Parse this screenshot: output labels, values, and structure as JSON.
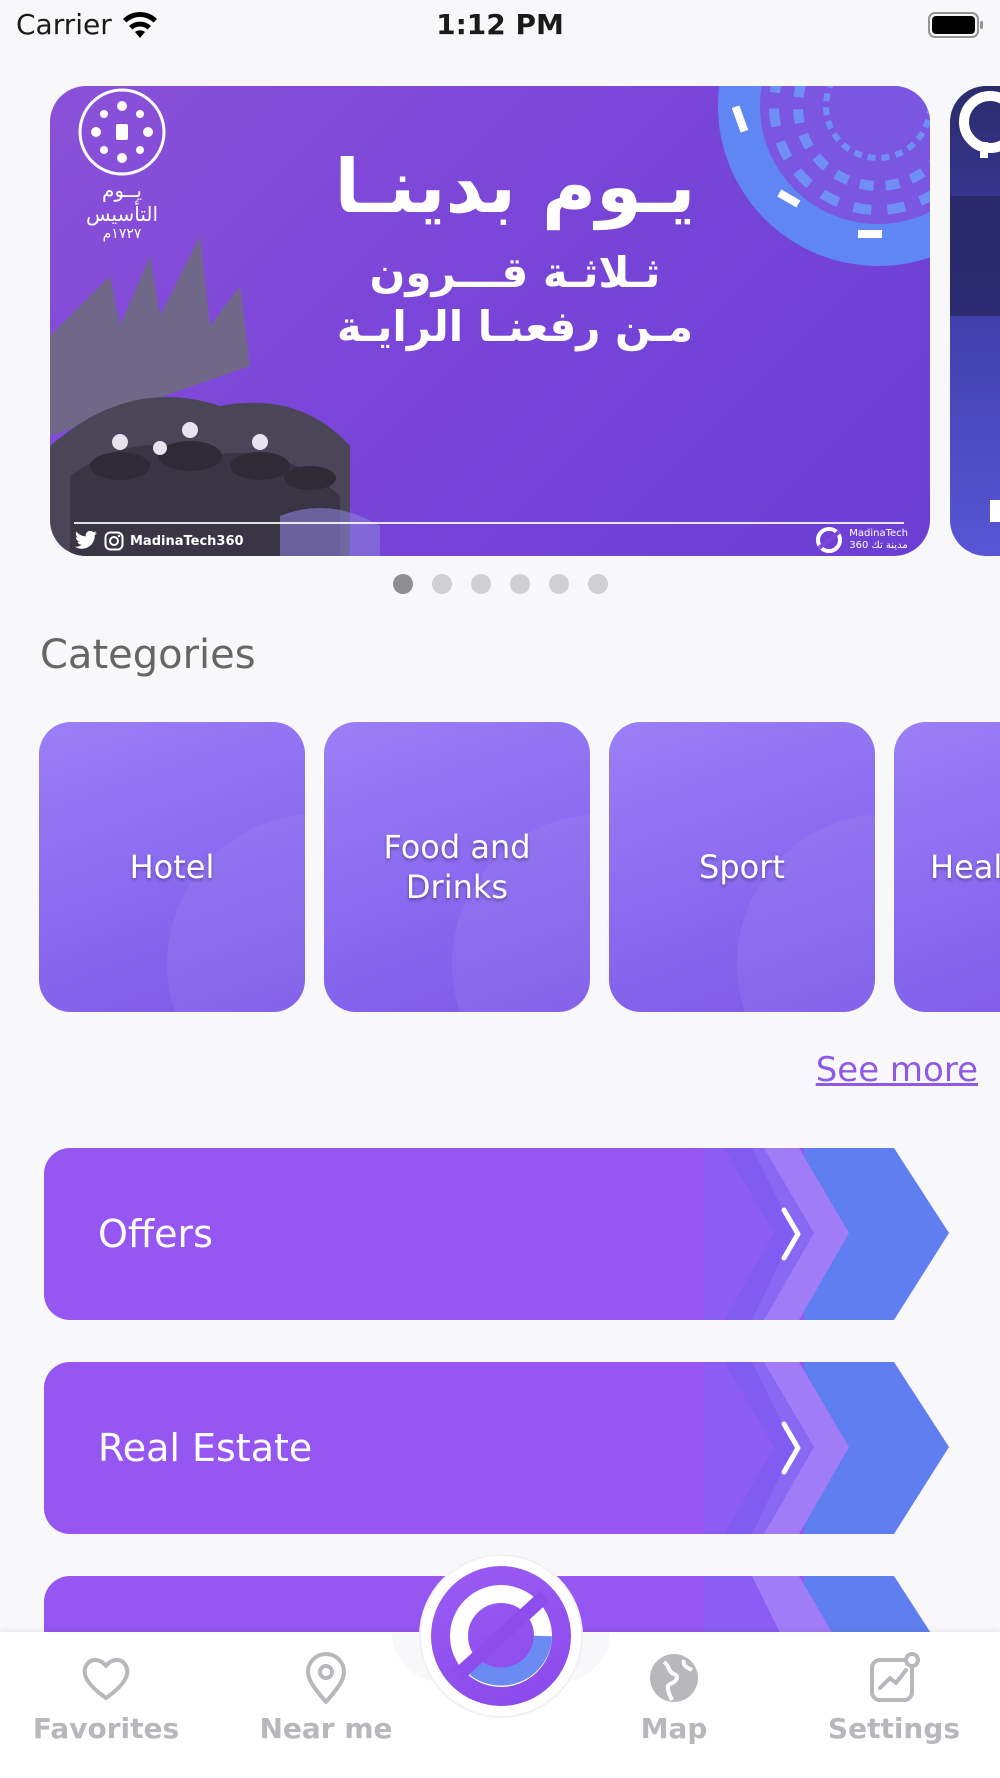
{
  "status_bar": {
    "carrier": "Carrier",
    "time": "1:12 PM"
  },
  "banner": {
    "headline": "يـوم بدينـا",
    "subline_1": "ثـلاثـة قـــرون",
    "subline_2": "مـن رفعنـا الرايـة",
    "emblem_text": "يــوم التأسيس",
    "emblem_year": "١٧٢٧م",
    "social_handle": "MadinaTech360",
    "brand_name": "MadinaTech",
    "brand_name_ar": "مدينة تك 360"
  },
  "carousel": {
    "page_count": 6,
    "active_index": 0
  },
  "categories": {
    "title": "Categories",
    "items": [
      {
        "label": "Hotel"
      },
      {
        "label": "Food and Drinks"
      },
      {
        "label": "Sport"
      },
      {
        "label": "Heal"
      }
    ],
    "see_more_label": "See more"
  },
  "features": [
    {
      "label": "Offers"
    },
    {
      "label": "Real Estate"
    },
    {
      "label": ""
    }
  ],
  "tab_bar": {
    "favorites": "Favorites",
    "near_me": "Near me",
    "map": "Map",
    "settings": "Settings"
  },
  "colors": {
    "accent_purple": "#9556f2",
    "category_card": "#8b6bf0",
    "chevron_blue": "#5f7ff0",
    "link_purple": "#8e5be9",
    "tab_inactive": "#b8b8bc"
  }
}
